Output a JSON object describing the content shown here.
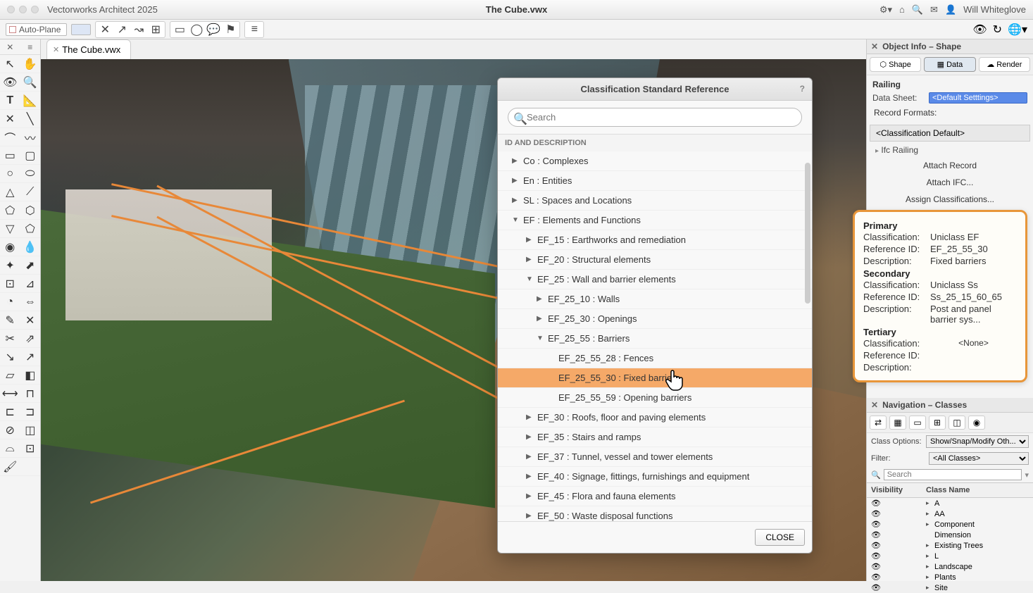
{
  "titlebar": {
    "app_name": "Vectorworks Architect 2025",
    "doc_title": "The Cube.vwx",
    "user_name": "Will Whiteglove"
  },
  "topbar": {
    "autoplane_label": "Auto-Plane"
  },
  "doc_tab": {
    "label": "The Cube.vwx"
  },
  "dialog": {
    "title": "Classification Standard Reference",
    "help": "?",
    "search_placeholder": "Search",
    "list_header": "ID AND DESCRIPTION",
    "close_label": "CLOSE",
    "rows": [
      {
        "level": 1,
        "arrow": "▶",
        "text": "Co : Complexes"
      },
      {
        "level": 1,
        "arrow": "▶",
        "text": "En : Entities"
      },
      {
        "level": 1,
        "arrow": "▶",
        "text": "SL : Spaces and Locations"
      },
      {
        "level": 1,
        "arrow": "▼",
        "text": "EF : Elements and Functions"
      },
      {
        "level": 2,
        "arrow": "▶",
        "text": "EF_15 : Earthworks and remediation"
      },
      {
        "level": 2,
        "arrow": "▶",
        "text": "EF_20 : Structural elements"
      },
      {
        "level": 2,
        "arrow": "▼",
        "text": "EF_25 : Wall and barrier elements"
      },
      {
        "level": 3,
        "arrow": "▶",
        "text": "EF_25_10 : Walls"
      },
      {
        "level": 3,
        "arrow": "▶",
        "text": "EF_25_30 : Openings"
      },
      {
        "level": 3,
        "arrow": "▼",
        "text": "EF_25_55 : Barriers"
      },
      {
        "level": 4,
        "arrow": "",
        "text": "EF_25_55_28 : Fences"
      },
      {
        "level": 4,
        "arrow": "",
        "text": "EF_25_55_30 : Fixed barriers",
        "selected": true
      },
      {
        "level": 4,
        "arrow": "",
        "text": "EF_25_55_59 : Opening barriers"
      },
      {
        "level": 2,
        "arrow": "▶",
        "text": "EF_30 : Roofs, floor and paving elements"
      },
      {
        "level": 2,
        "arrow": "▶",
        "text": "EF_35 : Stairs and ramps"
      },
      {
        "level": 2,
        "arrow": "▶",
        "text": "EF_37 : Tunnel, vessel and tower elements"
      },
      {
        "level": 2,
        "arrow": "▶",
        "text": "EF_40 : Signage, fittings, furnishings and equipment"
      },
      {
        "level": 2,
        "arrow": "▶",
        "text": "EF_45 : Flora and fauna elements"
      },
      {
        "level": 2,
        "arrow": "▶",
        "text": "EF_50 : Waste disposal functions"
      }
    ]
  },
  "obj_info": {
    "panel_title": "Object Info – Shape",
    "tabs": {
      "shape": "Shape",
      "data": "Data",
      "render": "Render"
    },
    "type_label": "Railing",
    "datasheet_label": "Data Sheet:",
    "datasheet_value": "<Default Setttings>",
    "record_formats_label": "Record Formats:",
    "record_default": "<Classification Default>",
    "ifc_item": "Ifc Railing",
    "attach_record": "Attach Record",
    "attach_ifc": "Attach IFC...",
    "assign_class": "Assign Classifications..."
  },
  "callout": {
    "primary_label": "Primary",
    "secondary_label": "Secondary",
    "tertiary_label": "Tertiary",
    "class_label": "Classification:",
    "ref_label": "Reference ID:",
    "desc_label": "Description:",
    "primary": {
      "classification": "Uniclass EF",
      "reference_id": "EF_25_55_30",
      "description": "Fixed barriers"
    },
    "secondary": {
      "classification": "Uniclass Ss",
      "reference_id": "Ss_25_15_60_65",
      "description": "Post and panel barrier sys..."
    },
    "tertiary_none": "<None>"
  },
  "nav": {
    "panel_title": "Navigation – Classes",
    "class_options_label": "Class Options:",
    "class_options_value": "Show/Snap/Modify Oth...",
    "filter_label": "Filter:",
    "filter_value": "<All Classes>",
    "search_placeholder": "Search",
    "col_visibility": "Visibility",
    "col_classname": "Class Name",
    "rows": [
      {
        "name": "A"
      },
      {
        "name": "AA"
      },
      {
        "name": "Component"
      },
      {
        "name": "Dimension",
        "no_arrow": true
      },
      {
        "name": "Existing Trees"
      },
      {
        "name": "L"
      },
      {
        "name": "Landscape"
      },
      {
        "name": "Plants"
      },
      {
        "name": "Site"
      }
    ]
  }
}
